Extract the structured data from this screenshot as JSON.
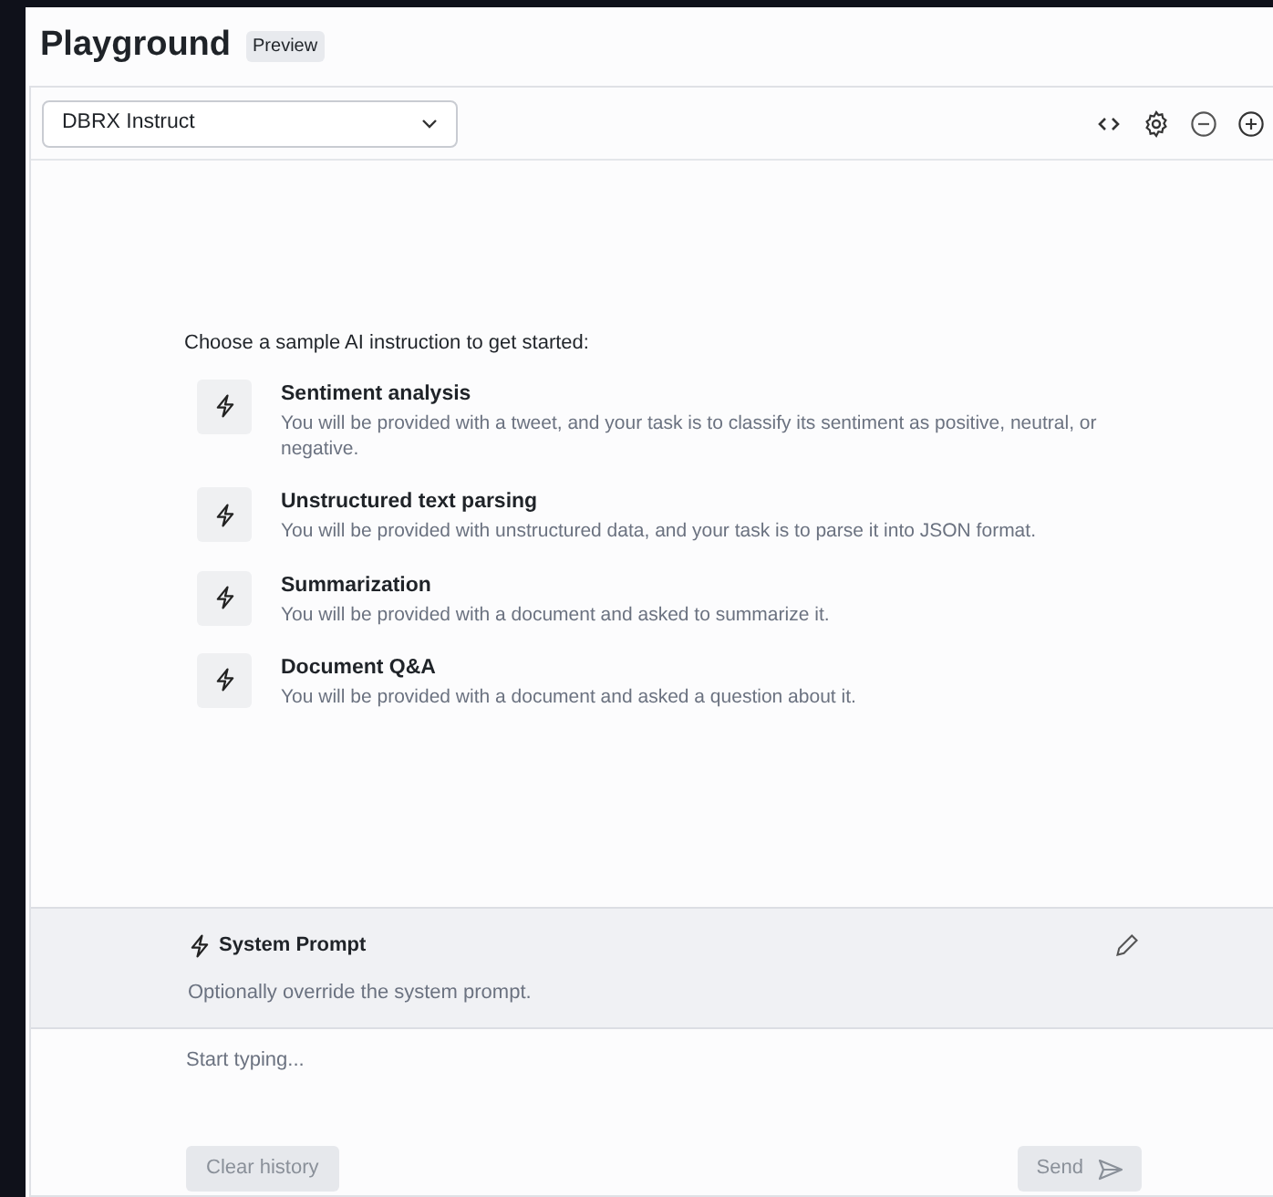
{
  "header": {
    "title": "Playground",
    "badge": "Preview"
  },
  "model_select": {
    "value": "DBRX Instruct"
  },
  "intro": "Choose a sample AI instruction to get started:",
  "samples": [
    {
      "title": "Sentiment analysis",
      "description": "You will be provided with a tweet, and your task is to classify its sentiment as positive, neutral, or negative."
    },
    {
      "title": "Unstructured text parsing",
      "description": "You will be provided with unstructured data, and your task is to parse it into JSON format."
    },
    {
      "title": "Summarization",
      "description": "You will be provided with a document and asked to summarize it."
    },
    {
      "title": "Document Q&A",
      "description": "You will be provided with a document and asked a question about it."
    }
  ],
  "system_prompt": {
    "title": "System Prompt",
    "hint": "Optionally override the system prompt."
  },
  "message_input": {
    "placeholder": "Start typing..."
  },
  "buttons": [
    {
      "label": "Clear history",
      "disabled": true,
      "kind": "clear"
    },
    {
      "label": "Send",
      "disabled": true,
      "kind": "send"
    }
  ]
}
